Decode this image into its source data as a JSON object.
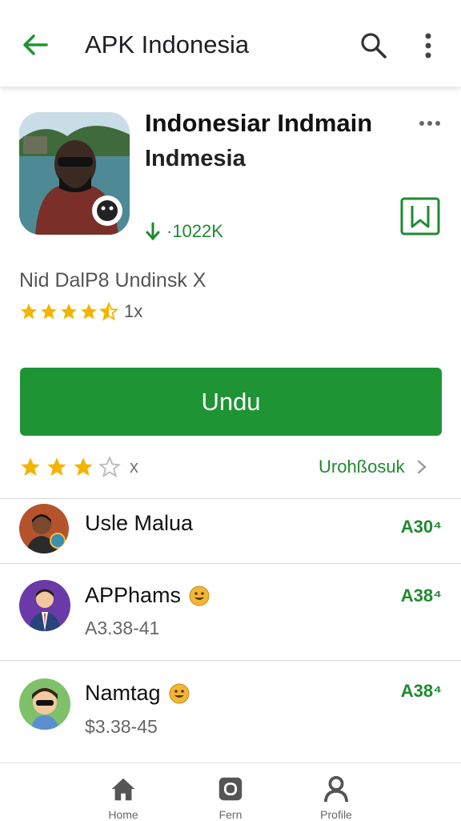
{
  "appbar": {
    "title": "APK Indonesia",
    "back_icon": "arrow-back-icon",
    "search_icon": "search-icon",
    "more_icon": "more-vert-icon"
  },
  "app": {
    "title": "Indonesiar Indmain",
    "subtitle": "Indmesia",
    "downloads": "·1022K",
    "developer": "Nid DalP8 Undinsk X",
    "rating_count": "1x",
    "rating_stars": 4.5
  },
  "install_button": {
    "label": "Undu"
  },
  "rating_row": {
    "stars": 3,
    "label": "x"
  },
  "reviews_link": {
    "label": "Urohßosuk"
  },
  "list": [
    {
      "name": "Usle Malua",
      "meta": "",
      "price": "A30⁴"
    },
    {
      "name": "APPhams",
      "meta": "A3.38-41",
      "price": "A38⁴"
    },
    {
      "name": "Namtag",
      "meta": "$3.38-45",
      "price": "A38⁴"
    }
  ],
  "bottom_nav": [
    {
      "label": "Home",
      "icon": "home-icon"
    },
    {
      "label": "Fern",
      "icon": "square-icon"
    },
    {
      "label": "Profile",
      "icon": "person-icon"
    }
  ],
  "colors": {
    "accent": "#1e9434",
    "star": "#f4b400"
  }
}
